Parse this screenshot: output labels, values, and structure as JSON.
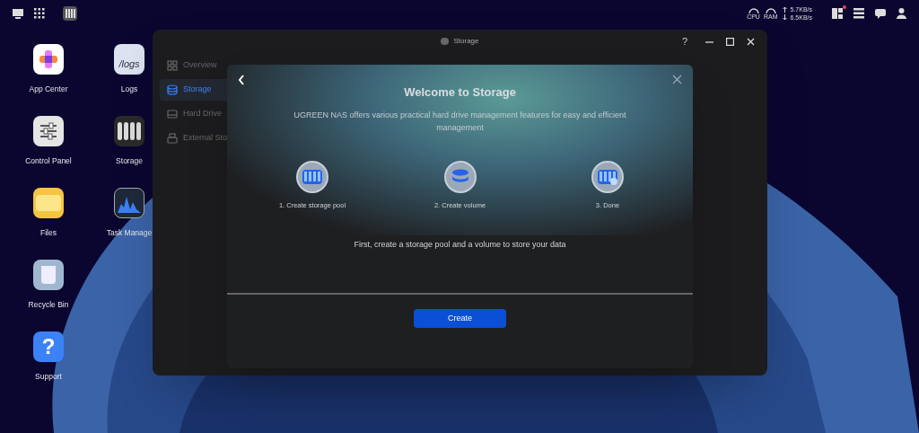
{
  "desktop_icons": [
    {
      "label": "App Center",
      "kind": "appcenter"
    },
    {
      "label": "Control Panel",
      "kind": "control"
    },
    {
      "label": "Files",
      "kind": "files"
    },
    {
      "label": "Recycle Bin",
      "kind": "bin"
    },
    {
      "label": "Support",
      "kind": "support",
      "icon_text": "?"
    },
    {
      "label": "Logs",
      "kind": "logs",
      "icon_text": "/logs"
    },
    {
      "label": "Storage",
      "kind": "storage"
    },
    {
      "label": "Task Manage",
      "kind": "task"
    }
  ],
  "status_bar": {
    "cpu": "CPU",
    "ram": "RAM",
    "upload": "5.7KB/s",
    "download": "6.5KB/s",
    "notification": true
  },
  "window": {
    "title": "Storage",
    "help": "?",
    "sidebar": [
      {
        "label": "Overview",
        "kind": "grid",
        "selected": false
      },
      {
        "label": "Storage",
        "kind": "db",
        "selected": true
      },
      {
        "label": "Hard Drive",
        "kind": "drive",
        "selected": false
      },
      {
        "label": "External Sto",
        "kind": "usb",
        "selected": false
      }
    ]
  },
  "dialog": {
    "title": "Welcome to Storage",
    "subtitle": "UGREEN NAS offers various practical hard drive management features for easy and efficient management",
    "steps": [
      {
        "label": "1. Create storage pool",
        "kind": "pool"
      },
      {
        "label": "2. Create volume",
        "kind": "volume"
      },
      {
        "label": "3. Done",
        "kind": "done"
      }
    ],
    "hint": "First, create a storage pool and a volume to store your data",
    "button": "Create"
  }
}
